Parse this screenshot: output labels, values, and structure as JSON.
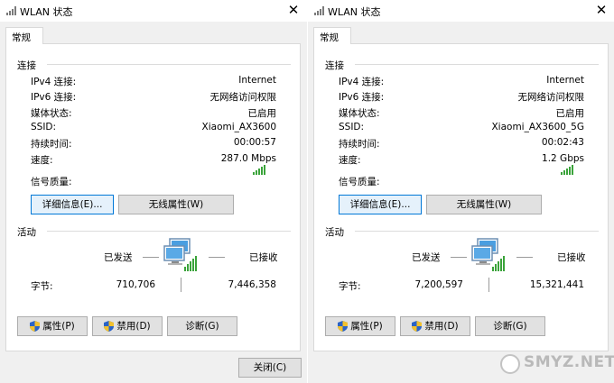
{
  "windows": [
    {
      "title": "WLAN 状态",
      "tab": "常规",
      "connection_section": "连接",
      "rows": [
        {
          "label": "IPv4 连接:",
          "value": "Internet"
        },
        {
          "label": "IPv6 连接:",
          "value": "无网络访问权限"
        },
        {
          "label": "媒体状态:",
          "value": "已启用"
        },
        {
          "label": "SSID:",
          "value": "Xiaomi_AX3600"
        },
        {
          "label": "持续时间:",
          "value": "00:00:57"
        },
        {
          "label": "速度:",
          "value": "287.0 Mbps"
        }
      ],
      "signal_label": "信号质量:",
      "details_button": "详细信息(E)...",
      "wireless_button": "无线属性(W)",
      "activity_section": "活动",
      "sent_label": "已发送",
      "received_label": "已接收",
      "bytes_label": "字节:",
      "bytes_sent": "710,706",
      "bytes_received": "7,446,358",
      "properties_button": "属性(P)",
      "disable_button": "禁用(D)",
      "diagnose_button": "诊断(G)"
    },
    {
      "title": "WLAN 状态",
      "tab": "常规",
      "connection_section": "连接",
      "rows": [
        {
          "label": "IPv4 连接:",
          "value": "Internet"
        },
        {
          "label": "IPv6 连接:",
          "value": "无网络访问权限"
        },
        {
          "label": "媒体状态:",
          "value": "已启用"
        },
        {
          "label": "SSID:",
          "value": "Xiaomi_AX3600_5G"
        },
        {
          "label": "持续时间:",
          "value": "00:02:43"
        },
        {
          "label": "速度:",
          "value": "1.2 Gbps"
        }
      ],
      "signal_label": "信号质量:",
      "details_button": "详细信息(E)...",
      "wireless_button": "无线属性(W)",
      "activity_section": "活动",
      "sent_label": "已发送",
      "received_label": "已接收",
      "bytes_label": "字节:",
      "bytes_sent": "7,200,597",
      "bytes_received": "15,321,441",
      "properties_button": "属性(P)",
      "disable_button": "禁用(D)",
      "diagnose_button": "诊断(G)"
    }
  ],
  "close_button": "关闭(C)",
  "watermark": "SMYZ.NET",
  "colors": {
    "focus_border": "#0078d7",
    "signal_green": "#3aa33a"
  }
}
